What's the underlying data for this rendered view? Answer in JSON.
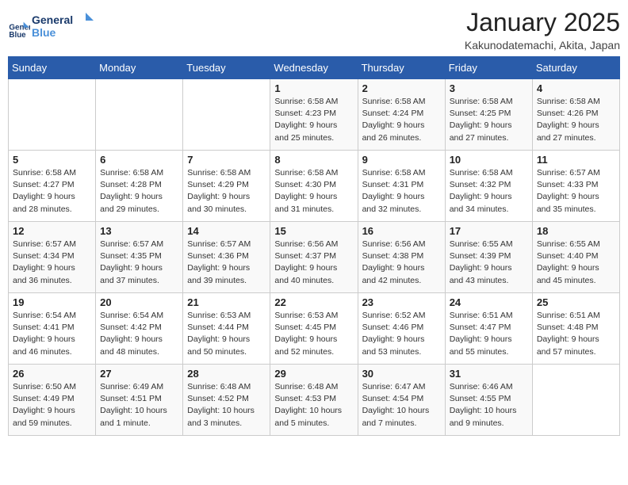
{
  "logo": {
    "line1": "General",
    "line2": "Blue"
  },
  "calendar": {
    "title": "January 2025",
    "subtitle": "Kakunodatemachi, Akita, Japan"
  },
  "weekdays": [
    "Sunday",
    "Monday",
    "Tuesday",
    "Wednesday",
    "Thursday",
    "Friday",
    "Saturday"
  ],
  "weeks": [
    [
      {
        "day": "",
        "info": ""
      },
      {
        "day": "",
        "info": ""
      },
      {
        "day": "",
        "info": ""
      },
      {
        "day": "1",
        "info": "Sunrise: 6:58 AM\nSunset: 4:23 PM\nDaylight: 9 hours and 25 minutes."
      },
      {
        "day": "2",
        "info": "Sunrise: 6:58 AM\nSunset: 4:24 PM\nDaylight: 9 hours and 26 minutes."
      },
      {
        "day": "3",
        "info": "Sunrise: 6:58 AM\nSunset: 4:25 PM\nDaylight: 9 hours and 27 minutes."
      },
      {
        "day": "4",
        "info": "Sunrise: 6:58 AM\nSunset: 4:26 PM\nDaylight: 9 hours and 27 minutes."
      }
    ],
    [
      {
        "day": "5",
        "info": "Sunrise: 6:58 AM\nSunset: 4:27 PM\nDaylight: 9 hours and 28 minutes."
      },
      {
        "day": "6",
        "info": "Sunrise: 6:58 AM\nSunset: 4:28 PM\nDaylight: 9 hours and 29 minutes."
      },
      {
        "day": "7",
        "info": "Sunrise: 6:58 AM\nSunset: 4:29 PM\nDaylight: 9 hours and 30 minutes."
      },
      {
        "day": "8",
        "info": "Sunrise: 6:58 AM\nSunset: 4:30 PM\nDaylight: 9 hours and 31 minutes."
      },
      {
        "day": "9",
        "info": "Sunrise: 6:58 AM\nSunset: 4:31 PM\nDaylight: 9 hours and 32 minutes."
      },
      {
        "day": "10",
        "info": "Sunrise: 6:58 AM\nSunset: 4:32 PM\nDaylight: 9 hours and 34 minutes."
      },
      {
        "day": "11",
        "info": "Sunrise: 6:57 AM\nSunset: 4:33 PM\nDaylight: 9 hours and 35 minutes."
      }
    ],
    [
      {
        "day": "12",
        "info": "Sunrise: 6:57 AM\nSunset: 4:34 PM\nDaylight: 9 hours and 36 minutes."
      },
      {
        "day": "13",
        "info": "Sunrise: 6:57 AM\nSunset: 4:35 PM\nDaylight: 9 hours and 37 minutes."
      },
      {
        "day": "14",
        "info": "Sunrise: 6:57 AM\nSunset: 4:36 PM\nDaylight: 9 hours and 39 minutes."
      },
      {
        "day": "15",
        "info": "Sunrise: 6:56 AM\nSunset: 4:37 PM\nDaylight: 9 hours and 40 minutes."
      },
      {
        "day": "16",
        "info": "Sunrise: 6:56 AM\nSunset: 4:38 PM\nDaylight: 9 hours and 42 minutes."
      },
      {
        "day": "17",
        "info": "Sunrise: 6:55 AM\nSunset: 4:39 PM\nDaylight: 9 hours and 43 minutes."
      },
      {
        "day": "18",
        "info": "Sunrise: 6:55 AM\nSunset: 4:40 PM\nDaylight: 9 hours and 45 minutes."
      }
    ],
    [
      {
        "day": "19",
        "info": "Sunrise: 6:54 AM\nSunset: 4:41 PM\nDaylight: 9 hours and 46 minutes."
      },
      {
        "day": "20",
        "info": "Sunrise: 6:54 AM\nSunset: 4:42 PM\nDaylight: 9 hours and 48 minutes."
      },
      {
        "day": "21",
        "info": "Sunrise: 6:53 AM\nSunset: 4:44 PM\nDaylight: 9 hours and 50 minutes."
      },
      {
        "day": "22",
        "info": "Sunrise: 6:53 AM\nSunset: 4:45 PM\nDaylight: 9 hours and 52 minutes."
      },
      {
        "day": "23",
        "info": "Sunrise: 6:52 AM\nSunset: 4:46 PM\nDaylight: 9 hours and 53 minutes."
      },
      {
        "day": "24",
        "info": "Sunrise: 6:51 AM\nSunset: 4:47 PM\nDaylight: 9 hours and 55 minutes."
      },
      {
        "day": "25",
        "info": "Sunrise: 6:51 AM\nSunset: 4:48 PM\nDaylight: 9 hours and 57 minutes."
      }
    ],
    [
      {
        "day": "26",
        "info": "Sunrise: 6:50 AM\nSunset: 4:49 PM\nDaylight: 9 hours and 59 minutes."
      },
      {
        "day": "27",
        "info": "Sunrise: 6:49 AM\nSunset: 4:51 PM\nDaylight: 10 hours and 1 minute."
      },
      {
        "day": "28",
        "info": "Sunrise: 6:48 AM\nSunset: 4:52 PM\nDaylight: 10 hours and 3 minutes."
      },
      {
        "day": "29",
        "info": "Sunrise: 6:48 AM\nSunset: 4:53 PM\nDaylight: 10 hours and 5 minutes."
      },
      {
        "day": "30",
        "info": "Sunrise: 6:47 AM\nSunset: 4:54 PM\nDaylight: 10 hours and 7 minutes."
      },
      {
        "day": "31",
        "info": "Sunrise: 6:46 AM\nSunset: 4:55 PM\nDaylight: 10 hours and 9 minutes."
      },
      {
        "day": "",
        "info": ""
      }
    ]
  ]
}
